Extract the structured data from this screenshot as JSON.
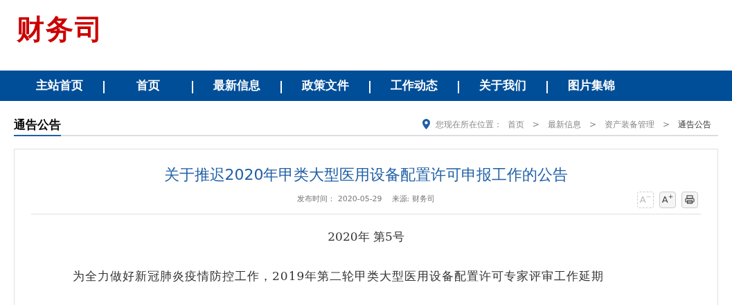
{
  "logo": "财务司",
  "nav": [
    {
      "label": "主站首页"
    },
    {
      "label": "|"
    },
    {
      "label": "首页"
    },
    {
      "label": "|"
    },
    {
      "label": "最新信息"
    },
    {
      "label": "|"
    },
    {
      "label": "政策文件"
    },
    {
      "label": "|"
    },
    {
      "label": "工作动态"
    },
    {
      "label": "|"
    },
    {
      "label": "关于我们"
    },
    {
      "label": "|"
    },
    {
      "label": "图片集锦"
    }
  ],
  "section_title": "通告公告",
  "breadcrumb": {
    "prefix": "您现在所在位置：",
    "items": [
      {
        "label": "首页",
        "current": false
      },
      {
        "label": "最新信息",
        "current": false
      },
      {
        "label": "资产装备管理",
        "current": false
      },
      {
        "label": "通告公告",
        "current": true
      }
    ],
    "separator": ">"
  },
  "article": {
    "title": "关于推迟2020年甲类大型医用设备配置许可申报工作的公告",
    "meta": "发布时间： 2020-05-29    来源: 财务司",
    "tools": [
      {
        "kind": "smaller",
        "label": "A",
        "sup": "−",
        "disabled": true
      },
      {
        "kind": "larger",
        "label": "A",
        "sup": "+",
        "disabled": false
      },
      {
        "kind": "print",
        "disabled": false
      }
    ],
    "number": "2020年 第5号",
    "paragraph": "为全力做好新冠肺炎疫情防控工作，2019年第二轮甲类大型医用设备配置许可专家评审工作延期"
  }
}
